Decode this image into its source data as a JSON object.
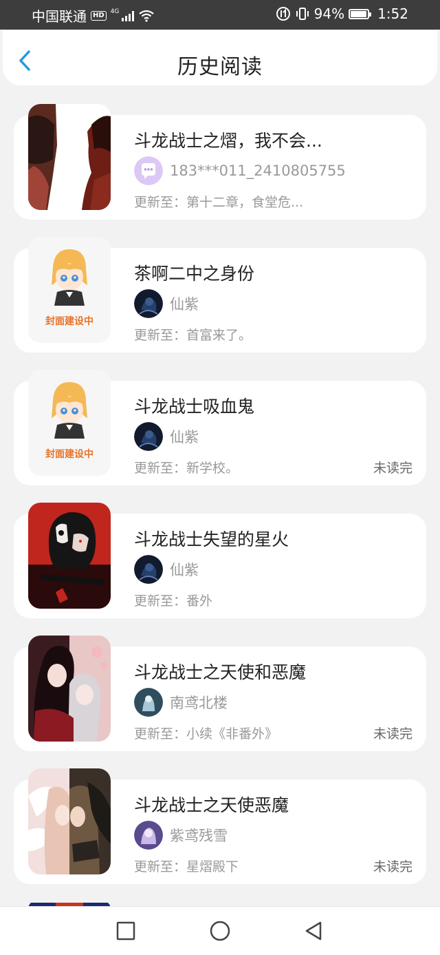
{
  "status_bar": {
    "carrier": "中国联通",
    "hd": "HD",
    "network": "4G",
    "battery": "94%",
    "battery_level": 0.94,
    "time": "1:52"
  },
  "header": {
    "title": "历史阅读",
    "back_icon": "chevron-left-icon",
    "accent_color": "#1e9be6"
  },
  "books": [
    {
      "title": "斗龙战士之熠，我不会...",
      "author": "183***011_2410805755",
      "update_prefix": "更新至：",
      "update": "第十二章，食堂危...",
      "unread": "",
      "cover": "anime-split-face",
      "avatar": "chat-bubble-icon"
    },
    {
      "title": "茶啊二中之身份",
      "author": "仙紫",
      "update_prefix": "更新至：",
      "update": "首富来了。",
      "unread": "",
      "cover": "placeholder",
      "cover_label": "封面建设中",
      "avatar": "dark-character-avatar"
    },
    {
      "title": "斗龙战士吸血鬼",
      "author": "仙紫",
      "update_prefix": "更新至：",
      "update": "新学校。",
      "unread": "未读完",
      "cover": "placeholder",
      "cover_label": "封面建设中",
      "avatar": "dark-character-avatar"
    },
    {
      "title": "斗龙战士失望的星火",
      "author": "仙紫",
      "update_prefix": "更新至：",
      "update": "番外",
      "unread": "",
      "cover": "anime-mask-red",
      "avatar": "dark-character-avatar"
    },
    {
      "title": "斗龙战士之天使和恶魔",
      "author": "南鸢北楼",
      "update_prefix": "更新至：",
      "update": "小续《非番外》",
      "unread": "未读完",
      "cover": "anime-gothic-pair",
      "avatar": "blue-figure-avatar"
    },
    {
      "title": "斗龙战士之天使恶魔",
      "author": "紫鸢残雪",
      "update_prefix": "更新至：",
      "update": "星熠殿下",
      "unread": "未读完",
      "cover": "anime-angel-demon",
      "avatar": "purple-figure-avatar"
    }
  ],
  "nav_bar": {
    "recent_icon": "square-icon",
    "home_icon": "circle-icon",
    "back_icon": "triangle-back-icon"
  }
}
